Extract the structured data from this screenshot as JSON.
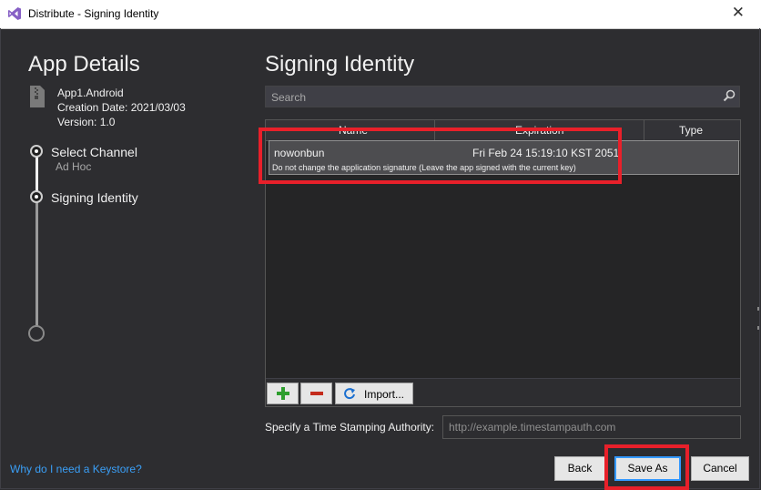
{
  "window": {
    "title": "Distribute - Signing Identity"
  },
  "app_details": {
    "heading": "App Details",
    "name": "App1.Android",
    "creation_date": "Creation Date: 2021/03/03",
    "version": "Version: 1.0"
  },
  "steps": [
    {
      "label": "Select Channel",
      "sub": "Ad Hoc"
    },
    {
      "label": "Signing Identity"
    }
  ],
  "keystore_link": "Why do I need a Keystore?",
  "signing": {
    "heading": "Signing Identity",
    "search_placeholder": "Search",
    "columns": [
      "Name",
      "Expiration",
      "Type"
    ],
    "rows": [
      {
        "alias": "nowonbun",
        "expiration": "Fri Feb 24 15:19:10 KST 2051",
        "note": "Do not change the application signature (Leave the app signed with the current key)"
      }
    ],
    "toolbar": {
      "add_label": "+",
      "remove_label": "−",
      "import_label": "Import..."
    }
  },
  "tsa": {
    "label": "Specify a Time Stamping Authority:",
    "placeholder": "http://example.timestampauth.com"
  },
  "buttons": {
    "back": "Back",
    "save_as": "Save As",
    "cancel": "Cancel"
  },
  "colors": {
    "accent": "#3399ff",
    "highlight": "#e8202a",
    "link": "#3a9ff7",
    "background": "#2d2d30"
  }
}
